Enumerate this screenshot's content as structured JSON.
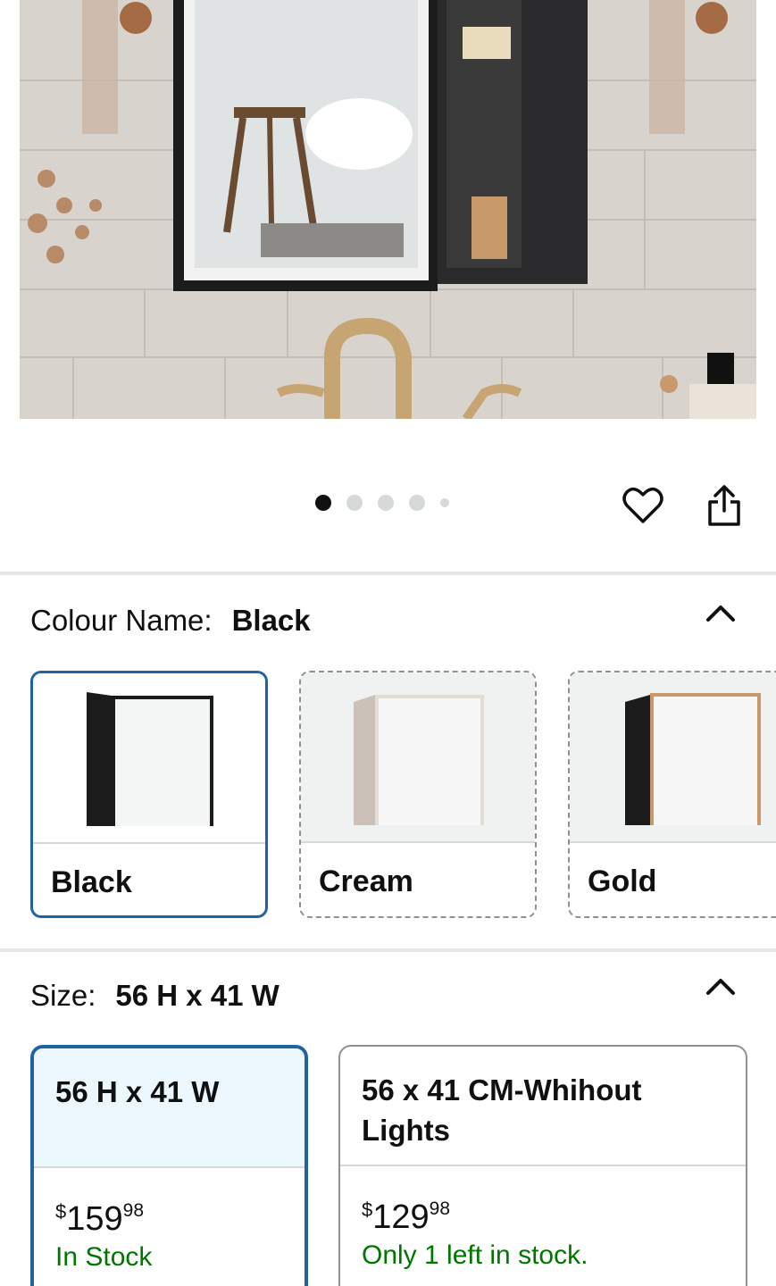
{
  "gallery": {
    "image_description_icon": "bathroom-mirror-cabinet-photo",
    "dots_total": 5,
    "active_index": 0
  },
  "actions": {
    "wishlist_icon": "heart-icon",
    "share_icon": "share-icon"
  },
  "colour": {
    "label": "Colour Name:",
    "selected": "Black",
    "options": [
      {
        "label": "Black",
        "frame_color": "#1b1b1b"
      },
      {
        "label": "Cream",
        "frame_color": "#c7beb6"
      },
      {
        "label": "Gold",
        "frame_color": "#c9986c"
      }
    ]
  },
  "size": {
    "label": "Size:",
    "selected": "56 H x 41 W",
    "options": [
      {
        "name": "56 H x 41 W",
        "currency": "$",
        "price_whole": "159",
        "price_fraction": "98",
        "stock": "In Stock"
      },
      {
        "name": "56 x 41 CM-Whihout Lights",
        "currency": "$",
        "price_whole": "129",
        "price_fraction": "98",
        "stock": "Only 1 left in stock."
      }
    ]
  },
  "colors": {
    "accent_blue": "#2162a1",
    "stock_green": "#007600",
    "selected_bg": "#edf7fe"
  }
}
